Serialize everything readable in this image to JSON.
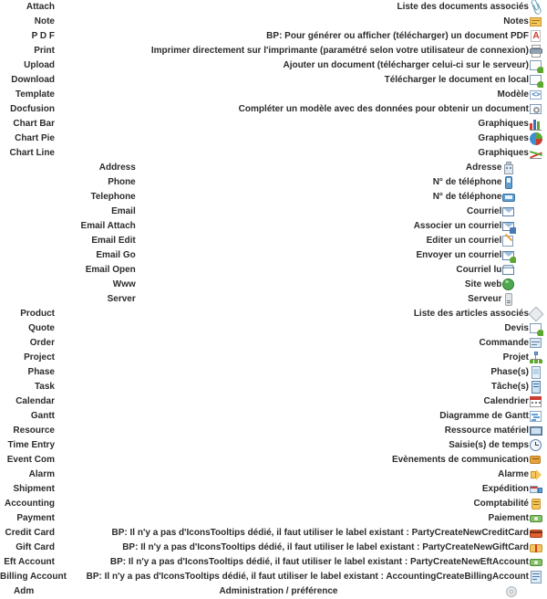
{
  "page": {
    "title": "Icons Tooltips reference"
  },
  "groups": [
    {
      "id": "documents",
      "layout": "wide",
      "rows": [
        {
          "key": "Attach",
          "desc": "Liste des documents associés",
          "icon": "paperclip-icon"
        },
        {
          "key": "Note",
          "desc": "Notes",
          "icon": "note-icon"
        },
        {
          "key": "P D F",
          "desc": "BP: Pour générer ou afficher (télécharger) un document PDF",
          "icon": "pdf-icon"
        },
        {
          "key": "Print",
          "desc": "Imprimer directement sur l'imprimante (paramétré selon votre utilisateur de connexion)",
          "icon": "printer-icon"
        },
        {
          "key": "Upload",
          "desc": "Ajouter un document (télécharger celui-ci sur le serveur)",
          "icon": "upload-icon"
        },
        {
          "key": "Download",
          "desc": "Télécharger le document en local",
          "icon": "download-icon"
        },
        {
          "key": "Template",
          "desc": "Modèle",
          "icon": "template-icon"
        },
        {
          "key": "Docfusion",
          "desc": "Compléter un modèle avec des données pour obtenir un document",
          "icon": "docfusion-icon"
        },
        {
          "key": "Chart Bar",
          "desc": "Graphiques",
          "icon": "chart-bar-icon"
        },
        {
          "key": "Chart Pie",
          "desc": "Graphiques",
          "icon": "chart-pie-icon"
        },
        {
          "key": "Chart Line",
          "desc": "Graphiques",
          "icon": "chart-line-icon"
        }
      ]
    },
    {
      "id": "contact",
      "layout": "narrow",
      "rows": [
        {
          "key": "Address",
          "desc": "Adresse",
          "icon": "address-icon"
        },
        {
          "key": "Phone",
          "desc": "N° de téléphone",
          "icon": "mobile-phone-icon"
        },
        {
          "key": "Telephone",
          "desc": "N° de téléphone",
          "icon": "telephone-icon"
        },
        {
          "key": "Email",
          "desc": "Courriel",
          "icon": "email-icon"
        },
        {
          "key": "Email Attach",
          "desc": "Associer un courriel",
          "icon": "email-attach-icon"
        },
        {
          "key": "Email Edit",
          "desc": "Editer un courriel",
          "icon": "email-edit-icon"
        },
        {
          "key": "Email Go",
          "desc": "Envoyer un courriel",
          "icon": "email-go-icon"
        },
        {
          "key": "Email Open",
          "desc": "Courriel lu",
          "icon": "email-open-icon"
        },
        {
          "key": "Www",
          "desc": "Site web",
          "icon": "world-icon"
        },
        {
          "key": "Server",
          "desc": "Serveur",
          "icon": "server-icon"
        }
      ]
    },
    {
      "id": "business",
      "layout": "wide",
      "rows": [
        {
          "key": "Product",
          "desc": "Liste des articles associés",
          "icon": "product-icon"
        },
        {
          "key": "Quote",
          "desc": "Devis",
          "icon": "quote-icon"
        },
        {
          "key": "Order",
          "desc": "Commande",
          "icon": "order-icon"
        },
        {
          "key": "Project",
          "desc": "Projet",
          "icon": "project-icon"
        },
        {
          "key": "Phase",
          "desc": "Phase(s)",
          "icon": "phase-icon"
        },
        {
          "key": "Task",
          "desc": "Tâche(s)",
          "icon": "task-icon"
        },
        {
          "key": "Calendar",
          "desc": "Calendrier",
          "icon": "calendar-icon"
        },
        {
          "key": "Gantt",
          "desc": "Diagramme de Gantt",
          "icon": "gantt-icon"
        },
        {
          "key": "Resource",
          "desc": "Ressource matériel",
          "icon": "resource-icon"
        },
        {
          "key": "Time Entry",
          "desc": "Saisie(s) de temps",
          "icon": "time-entry-icon"
        },
        {
          "key": "Event Com",
          "desc": "Evènements de communication",
          "icon": "event-com-icon"
        },
        {
          "key": "Alarm",
          "desc": "Alarme",
          "icon": "alarm-icon"
        },
        {
          "key": "Shipment",
          "desc": "Expédition",
          "icon": "shipment-icon"
        },
        {
          "key": "Accounting",
          "desc": "Comptabilité",
          "icon": "accounting-icon"
        },
        {
          "key": "Payment",
          "desc": "Paiement",
          "icon": "payment-icon"
        },
        {
          "key": "Credit Card",
          "desc": "BP: Il n'y a pas d'IconsTooltips dédié, il faut utiliser le label existant : PartyCreateNewCreditCard",
          "icon": "credit-card-icon"
        },
        {
          "key": "Gift Card",
          "desc": "BP: Il n'y a pas d'IconsTooltips dédié, il faut utiliser le label existant : PartyCreateNewGiftCard",
          "icon": "gift-card-icon"
        },
        {
          "key": "Eft Account",
          "desc": "BP: Il n'y a pas d'IconsTooltips dédié, il faut utiliser le label existant : PartyCreateNewEftAccount",
          "icon": "eft-account-icon"
        },
        {
          "key": "Billing Account",
          "desc": "BP: Il n'y a pas d'IconsTooltips dédié, il faut utiliser le label existant : AccountingCreateBillingAccount",
          "icon": "billing-account-icon"
        }
      ]
    },
    {
      "id": "administration",
      "layout": "left",
      "rows": [
        {
          "key": "Adm",
          "desc": "Administration / préférence",
          "icon": "gear-icon"
        }
      ]
    }
  ],
  "colors": {
    "text": "#2b2b2b",
    "background": "#ffffff",
    "icon_blue": "#4a78b5",
    "icon_green": "#5ea832",
    "icon_orange": "#e8a33d",
    "icon_red": "#cc3b2f"
  }
}
